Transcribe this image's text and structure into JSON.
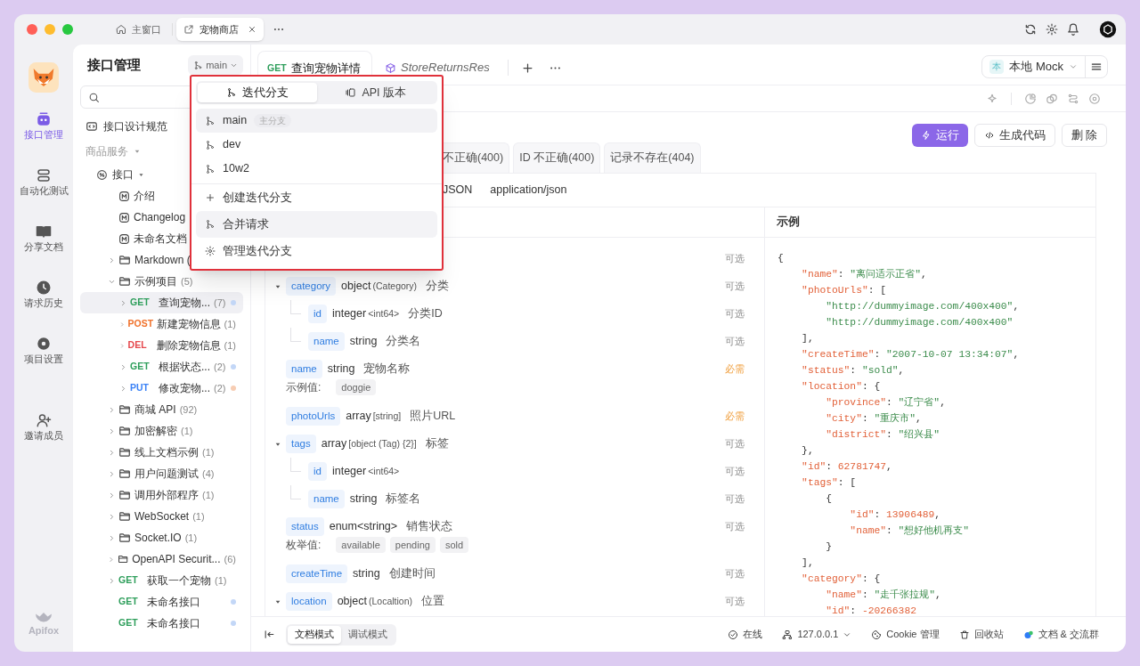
{
  "window": {
    "tabs": [
      {
        "kind": "home",
        "label": "主窗口",
        "selected": false
      },
      {
        "kind": "project",
        "label": "宠物商店",
        "selected": true
      }
    ]
  },
  "rail": {
    "items": [
      {
        "kind": "apis",
        "label": "接口管理",
        "selected": true
      },
      {
        "kind": "tests",
        "label": "自动化测试",
        "selected": false
      },
      {
        "kind": "docs",
        "label": "分享文档",
        "selected": false
      },
      {
        "kind": "history",
        "label": "请求历史",
        "selected": false
      },
      {
        "kind": "settings",
        "label": "项目设置",
        "selected": false
      }
    ],
    "footer_items": [
      {
        "kind": "invite",
        "label": "邀请成员",
        "selected": false
      }
    ],
    "brand": "Apifox"
  },
  "sidebar": {
    "title": "接口管理",
    "branch": "main",
    "spec_link": "接口设计规范",
    "section": {
      "label": "商品服务",
      "expanded": true
    },
    "tree": [
      {
        "kind": "group",
        "label": "接口",
        "expanded": true,
        "selected": false,
        "children": [
          {
            "kind": "doc",
            "label": "介绍",
            "selected": false
          },
          {
            "kind": "doc",
            "label": "Changelog",
            "selected": false
          },
          {
            "kind": "doc",
            "label": "未命名文档",
            "selected": false
          },
          {
            "kind": "folder",
            "label": "Markdown (",
            "expanded": false,
            "selected": false
          },
          {
            "kind": "folder",
            "label": "示例项目",
            "count": "(5)",
            "expanded": true,
            "selected": false,
            "children": [
              {
                "kind": "endpoint",
                "method": {
                  "text": "GET",
                  "color": "#2e9e5b"
                },
                "label": "查询宠物...",
                "count": "(7)",
                "dot": {
                  "color": "#c3d7f7"
                },
                "expanded": false,
                "selected": true
              },
              {
                "kind": "endpoint",
                "method": {
                  "text": "POST",
                  "color": "#f0712a"
                },
                "label": "新建宠物信息",
                "count": "(1)",
                "expanded": false,
                "selected": false
              },
              {
                "kind": "endpoint",
                "method": {
                  "text": "DEL",
                  "color": "#e5484d"
                },
                "label": "删除宠物信息",
                "count": "(1)",
                "expanded": false,
                "selected": false
              },
              {
                "kind": "endpoint",
                "method": {
                  "text": "GET",
                  "color": "#2e9e5b"
                },
                "label": "根据状态...",
                "count": "(2)",
                "dot": {
                  "color": "#c3d7f7"
                },
                "expanded": false,
                "selected": false
              },
              {
                "kind": "endpoint",
                "method": {
                  "text": "PUT",
                  "color": "#3b82f6"
                },
                "label": "修改宠物...",
                "count": "(2)",
                "dot": {
                  "color": "#f7cdb3"
                },
                "expanded": false,
                "selected": false
              }
            ]
          },
          {
            "kind": "folder",
            "label": "商城 API",
            "count": "(92)",
            "expanded": false,
            "selected": false
          },
          {
            "kind": "folder",
            "label": "加密解密",
            "count": "(1)",
            "expanded": false,
            "selected": false
          },
          {
            "kind": "folder",
            "label": "线上文档示例",
            "count": "(1)",
            "expanded": false,
            "selected": false
          },
          {
            "kind": "folder",
            "label": "用户问题测试",
            "count": "(4)",
            "expanded": false,
            "selected": false
          },
          {
            "kind": "folder",
            "label": "调用外部程序",
            "count": "(1)",
            "expanded": false,
            "selected": false
          },
          {
            "kind": "folder",
            "label": "WebSocket",
            "count": "(1)",
            "expanded": false,
            "selected": false
          },
          {
            "kind": "folder",
            "label": "Socket.IO",
            "count": "(1)",
            "expanded": false,
            "selected": false
          },
          {
            "kind": "folder",
            "label": "OpenAPI Securit...",
            "count": "(6)",
            "expanded": false,
            "selected": false
          },
          {
            "kind": "endpoint",
            "method": {
              "text": "GET",
              "color": "#2e9e5b"
            },
            "label": "获取一个宠物",
            "count": "(1)",
            "expanded": false,
            "selected": false
          },
          {
            "kind": "endpoint",
            "method": {
              "text": "GET",
              "color": "#2e9e5b"
            },
            "label": "未命名接口",
            "dot": {
              "color": "#c3d7f7"
            },
            "selected": false
          },
          {
            "kind": "endpoint",
            "method": {
              "text": "GET",
              "color": "#2e9e5b"
            },
            "label": "未命名接口",
            "dot": {
              "color": "#c3d7f7"
            },
            "selected": false
          }
        ]
      }
    ]
  },
  "branch_menu": {
    "tabs": [
      {
        "kind": "branches",
        "label": "迭代分支",
        "selected": true
      },
      {
        "kind": "versions",
        "label": "API 版本",
        "selected": false
      }
    ],
    "branches": [
      {
        "name": "main",
        "badge": "主分支",
        "selected": true
      },
      {
        "name": "dev",
        "selected": false
      },
      {
        "name": "10w2",
        "selected": false
      }
    ],
    "actions": [
      {
        "kind": "create",
        "label": "创建迭代分支",
        "highlighted": false
      },
      {
        "kind": "merge",
        "label": "合并请求",
        "highlighted": true
      },
      {
        "kind": "manage",
        "label": "管理迭代分支",
        "highlighted": false
      }
    ]
  },
  "content": {
    "tabs": [
      {
        "kind": "endpoint",
        "method": {
          "text": "GET",
          "color": "#2e9e5b"
        },
        "label": "查询宠物详情",
        "selected": true
      },
      {
        "kind": "schema",
        "label": "StoreReturnsRes",
        "selected": false
      }
    ],
    "environment": {
      "badge": "本",
      "label": "本地 Mock"
    },
    "actions": [
      {
        "kind": "primary",
        "label": "运行"
      },
      {
        "kind": "code",
        "label": "生成代码"
      },
      {
        "kind": "plain",
        "label": "删 除"
      }
    ],
    "response_tabs": [
      {
        "label": "不正确(400)",
        "selected": false
      },
      {
        "label": "ID 不正确(400)",
        "selected": false
      },
      {
        "label": "记录不存在(404)",
        "selected": false
      }
    ],
    "content_type": {
      "format": "JSON",
      "mime": "application/json"
    },
    "example_heading": "示例",
    "fields": [
      {
        "requirement": {
          "text": "可选",
          "required": false
        }
      },
      {
        "name": "category",
        "type": "object",
        "type_detail": "(Category)",
        "description": "分类",
        "expanded": true,
        "requirement": {
          "text": "可选",
          "required": false
        },
        "children": [
          {
            "name": "id",
            "type": "integer",
            "type_detail": "<int64>",
            "description": "分类ID",
            "requirement": {
              "text": "可选",
              "required": false
            }
          },
          {
            "name": "name",
            "type": "string",
            "description": "分类名",
            "requirement": {
              "text": "可选",
              "required": false
            }
          }
        ]
      },
      {
        "name": "name",
        "type": "string",
        "description": "宠物名称",
        "requirement": {
          "text": "必需",
          "required": true
        },
        "values_label": "示例值:",
        "values": [
          "doggie"
        ]
      },
      {
        "name": "photoUrls",
        "type": "array",
        "type_detail": "[string]",
        "description": "照片URL",
        "requirement": {
          "text": "必需",
          "required": true
        }
      },
      {
        "name": "tags",
        "type": "array",
        "type_detail": "[object (Tag) {2}]",
        "description": "标签",
        "expanded": true,
        "requirement": {
          "text": "可选",
          "required": false
        },
        "children": [
          {
            "name": "id",
            "type": "integer",
            "type_detail": "<int64>",
            "requirement": {
              "text": "可选",
              "required": false
            }
          },
          {
            "name": "name",
            "type": "string",
            "description": "标签名",
            "requirement": {
              "text": "可选",
              "required": false
            }
          }
        ]
      },
      {
        "name": "status",
        "type": "enum<string>",
        "description": "销售状态",
        "requirement": {
          "text": "可选",
          "required": false
        },
        "values_label": "枚举值:",
        "values": [
          "available",
          "pending",
          "sold"
        ]
      },
      {
        "name": "createTime",
        "type": "string",
        "description": "创建时间",
        "requirement": {
          "text": "可选",
          "required": false
        }
      },
      {
        "name": "location",
        "type": "object",
        "type_detail": "(Localtion)",
        "description": "位置",
        "expanded": true,
        "requirement": {
          "text": "可选",
          "required": false
        }
      }
    ],
    "example_lines": [
      {
        "segments": [
          {
            "kind": "punct",
            "text": "{"
          }
        ]
      },
      {
        "segments": [
          {
            "kind": "key",
            "text": "    \"name\""
          },
          {
            "kind": "punct",
            "text": ": "
          },
          {
            "kind": "string",
            "text": "\"离问适示正省\""
          },
          {
            "kind": "punct",
            "text": ","
          }
        ]
      },
      {
        "segments": [
          {
            "kind": "key",
            "text": "    \"photoUrls\""
          },
          {
            "kind": "punct",
            "text": ": ["
          }
        ]
      },
      {
        "segments": [
          {
            "kind": "string",
            "text": "        \"http://dummyimage.com/400x400\""
          },
          {
            "kind": "punct",
            "text": ","
          }
        ]
      },
      {
        "segments": [
          {
            "kind": "string",
            "text": "        \"http://dummyimage.com/400x400\""
          }
        ]
      },
      {
        "segments": [
          {
            "kind": "punct",
            "text": "    ],"
          }
        ]
      },
      {
        "segments": [
          {
            "kind": "key",
            "text": "    \"createTime\""
          },
          {
            "kind": "punct",
            "text": ": "
          },
          {
            "kind": "string",
            "text": "\"2007-10-07 13:34:07\""
          },
          {
            "kind": "punct",
            "text": ","
          }
        ]
      },
      {
        "segments": [
          {
            "kind": "key",
            "text": "    \"status\""
          },
          {
            "kind": "punct",
            "text": ": "
          },
          {
            "kind": "string",
            "text": "\"sold\""
          },
          {
            "kind": "punct",
            "text": ","
          }
        ]
      },
      {
        "segments": [
          {
            "kind": "key",
            "text": "    \"location\""
          },
          {
            "kind": "punct",
            "text": ": {"
          }
        ]
      },
      {
        "segments": [
          {
            "kind": "key",
            "text": "        \"province\""
          },
          {
            "kind": "punct",
            "text": ": "
          },
          {
            "kind": "string",
            "text": "\"辽宁省\""
          },
          {
            "kind": "punct",
            "text": ","
          }
        ]
      },
      {
        "segments": [
          {
            "kind": "key",
            "text": "        \"city\""
          },
          {
            "kind": "punct",
            "text": ": "
          },
          {
            "kind": "string",
            "text": "\"重庆市\""
          },
          {
            "kind": "punct",
            "text": ","
          }
        ]
      },
      {
        "segments": [
          {
            "kind": "key",
            "text": "        \"district\""
          },
          {
            "kind": "punct",
            "text": ": "
          },
          {
            "kind": "string",
            "text": "\"绍兴县\""
          }
        ]
      },
      {
        "segments": [
          {
            "kind": "punct",
            "text": "    },"
          }
        ]
      },
      {
        "segments": [
          {
            "kind": "key",
            "text": "    \"id\""
          },
          {
            "kind": "punct",
            "text": ": "
          },
          {
            "kind": "number",
            "text": "62781747"
          },
          {
            "kind": "punct",
            "text": ","
          }
        ]
      },
      {
        "segments": [
          {
            "kind": "key",
            "text": "    \"tags\""
          },
          {
            "kind": "punct",
            "text": ": ["
          }
        ]
      },
      {
        "segments": [
          {
            "kind": "punct",
            "text": "        {"
          }
        ]
      },
      {
        "segments": [
          {
            "kind": "key",
            "text": "            \"id\""
          },
          {
            "kind": "punct",
            "text": ": "
          },
          {
            "kind": "number",
            "text": "13906489"
          },
          {
            "kind": "punct",
            "text": ","
          }
        ]
      },
      {
        "segments": [
          {
            "kind": "key",
            "text": "            \"name\""
          },
          {
            "kind": "punct",
            "text": ": "
          },
          {
            "kind": "string",
            "text": "\"想好他机再支\""
          }
        ]
      },
      {
        "segments": [
          {
            "kind": "punct",
            "text": "        }"
          }
        ]
      },
      {
        "segments": [
          {
            "kind": "punct",
            "text": "    ],"
          }
        ]
      },
      {
        "segments": [
          {
            "kind": "key",
            "text": "    \"category\""
          },
          {
            "kind": "punct",
            "text": ": {"
          }
        ]
      },
      {
        "segments": [
          {
            "kind": "key",
            "text": "        \"name\""
          },
          {
            "kind": "punct",
            "text": ": "
          },
          {
            "kind": "string",
            "text": "\"走千张拉规\""
          },
          {
            "kind": "punct",
            "text": ","
          }
        ]
      },
      {
        "segments": [
          {
            "kind": "key",
            "text": "        \"id\""
          },
          {
            "kind": "punct",
            "text": ": "
          },
          {
            "kind": "number",
            "text": "-20266382"
          }
        ]
      }
    ]
  },
  "status_bar": {
    "modes": [
      {
        "label": "文档模式",
        "selected": true
      },
      {
        "label": "调试模式",
        "selected": false
      }
    ],
    "items": [
      {
        "kind": "online",
        "label": "在线"
      },
      {
        "kind": "server",
        "label": "127.0.0.1"
      },
      {
        "kind": "cookie",
        "label": "Cookie 管理"
      },
      {
        "kind": "trash",
        "label": "回收站"
      },
      {
        "kind": "community",
        "label": "文档 & 交流群"
      }
    ]
  }
}
